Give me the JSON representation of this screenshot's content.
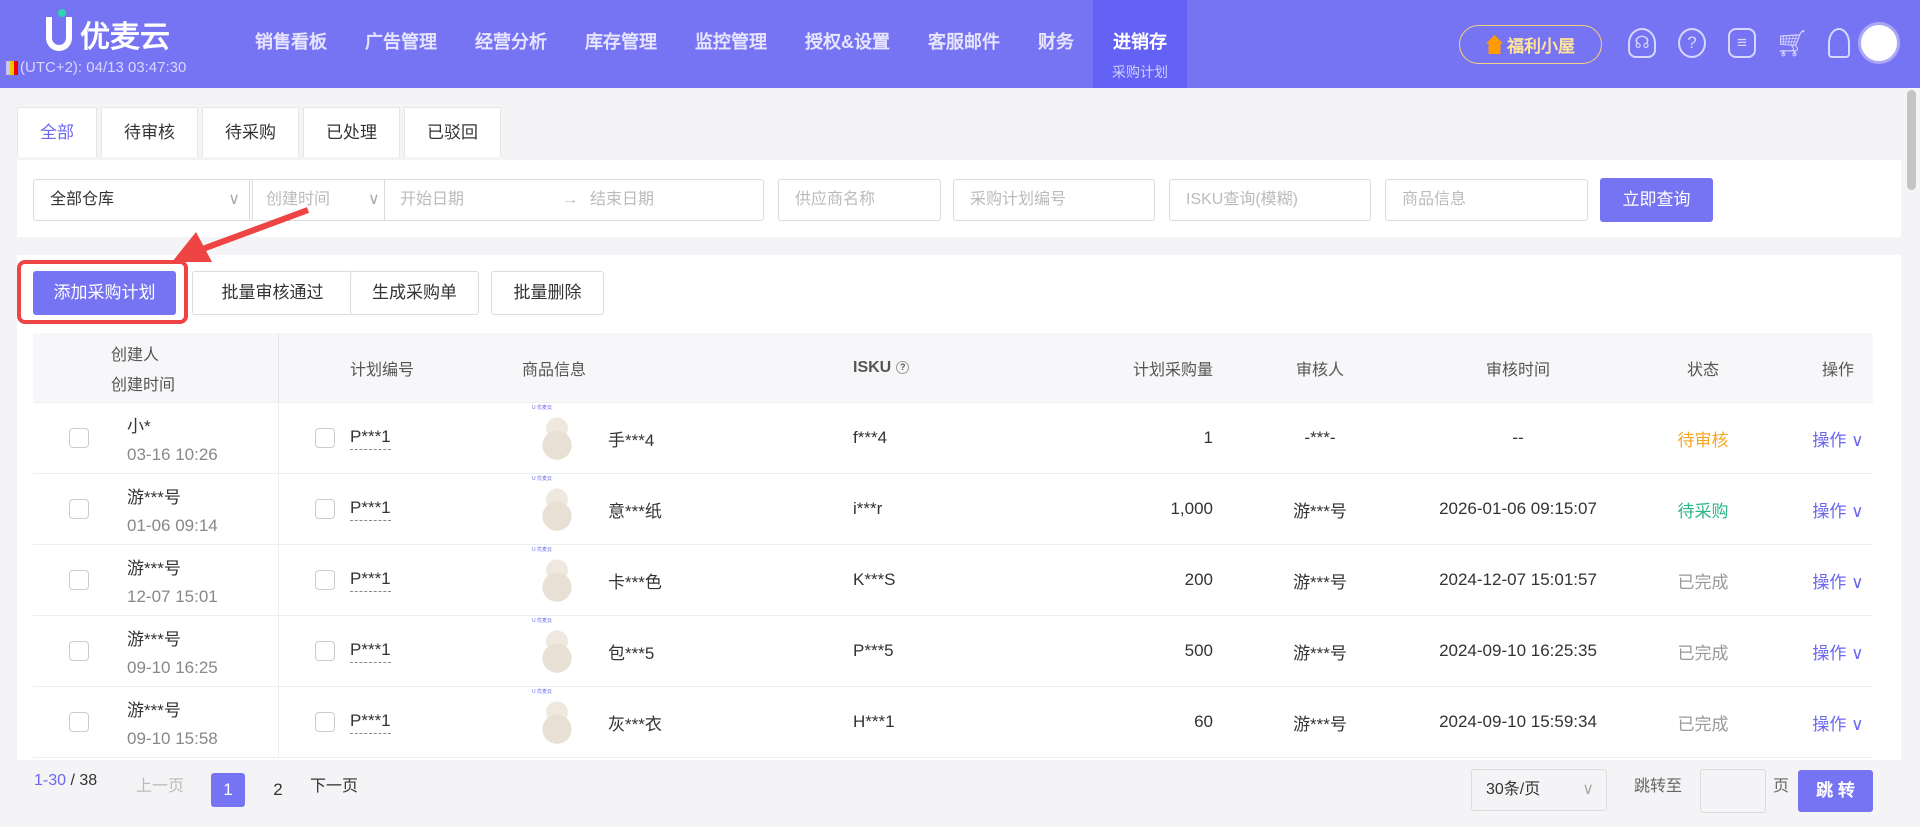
{
  "header": {
    "logo": "优麦云",
    "clock": "(UTC+2): 04/13 03:47:30",
    "nav": [
      "销售看板",
      "广告管理",
      "经营分析",
      "库存管理",
      "监控管理",
      "授权&设置",
      "客服邮件",
      "财务"
    ],
    "active_nav": "进销存",
    "active_sub": "采购计划",
    "welfare": "福利小屋"
  },
  "tabs": [
    "全部",
    "待审核",
    "待采购",
    "已处理",
    "已驳回"
  ],
  "filters": {
    "warehouse": "全部仓库",
    "date_type": "创建时间",
    "start": "开始日期",
    "arrow": "→",
    "end": "结束日期",
    "supplier": "供应商名称",
    "plan_no": "采购计划编号",
    "isku": "ISKU查询(模糊)",
    "goods": "商品信息",
    "query": "立即查询"
  },
  "actions": {
    "add": "添加采购计划",
    "batch_approve": "批量审核通过",
    "gen_order": "生成采购单",
    "batch_delete": "批量删除"
  },
  "columns": {
    "creator": "创建人",
    "created": "创建时间",
    "plan_no": "计划编号",
    "goods": "商品信息",
    "isku": "ISKU",
    "qty": "计划采购量",
    "reviewer": "审核人",
    "review_time": "审核时间",
    "status": "状态",
    "ops": "操作"
  },
  "rows": [
    {
      "creator": "小*",
      "time": "03-16 10:26",
      "plan": "P***1",
      "goods": "手***4",
      "isku": "f***4",
      "qty": "1",
      "reviewer": "-***-",
      "review_time": "--",
      "status": "待审核",
      "status_color": "#f5a623",
      "op": "操作 ∨"
    },
    {
      "creator": "游***号",
      "time": "01-06 09:14",
      "plan": "P***1",
      "goods": "意***纸",
      "isku": "i***r",
      "qty": "1,000",
      "reviewer": "游***号",
      "review_time": "2026-01-06 09:15:07",
      "status": "待采购",
      "status_color": "#2bb58a",
      "op": "操作 ∨"
    },
    {
      "creator": "游***号",
      "time": "12-07 15:01",
      "plan": "P***1",
      "goods": "卡***色",
      "isku": "K***S",
      "qty": "200",
      "reviewer": "游***号",
      "review_time": "2024-12-07 15:01:57",
      "status": "已完成",
      "status_color": "#999999",
      "op": "操作 ∨"
    },
    {
      "creator": "游***号",
      "time": "09-10 16:25",
      "plan": "P***1",
      "goods": "包***5",
      "isku": "P***5",
      "qty": "500",
      "reviewer": "游***号",
      "review_time": "2024-09-10 16:25:35",
      "status": "已完成",
      "status_color": "#999999",
      "op": "操作 ∨"
    },
    {
      "creator": "游***号",
      "time": "09-10 15:58",
      "plan": "P***1",
      "goods": "灰***衣",
      "isku": "H***1",
      "qty": "60",
      "reviewer": "游***号",
      "review_time": "2024-09-10 15:59:34",
      "status": "已完成",
      "status_color": "#999999",
      "op": "操作 ∨"
    }
  ],
  "pagination": {
    "range": "1-30",
    "total": "38",
    "prev": "上一页",
    "pages": [
      "1",
      "2"
    ],
    "next": "下一页",
    "per_page": "30条/页",
    "jump_label": "跳转至",
    "page_unit": "页",
    "jump": "跳 转"
  }
}
